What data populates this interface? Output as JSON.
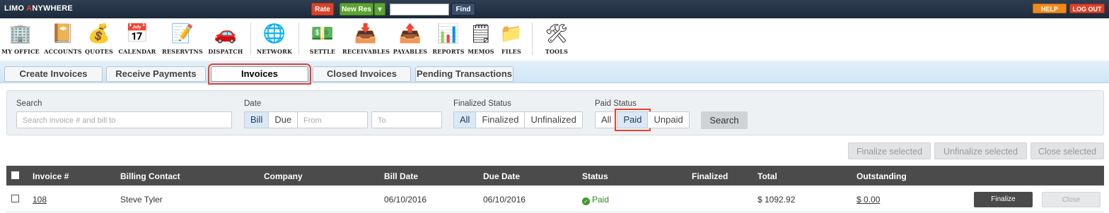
{
  "topbar": {
    "logo_left": "LIMO ",
    "logo_mark": "A",
    "logo_right": "NYWHERE",
    "rate_label": "Rate",
    "newres_label": "New Res",
    "newres_dropdown": "▾",
    "find_label": "Find",
    "search_value": "",
    "help_label": "HELP",
    "logout_label": "LOG OUT"
  },
  "iconbar": {
    "items": [
      {
        "label": "MY OFFICE",
        "icon": "office-building-icon",
        "glyph": "🏢"
      },
      {
        "label": "ACCOUNTS",
        "icon": "address-book-icon",
        "glyph": "📔"
      },
      {
        "label": "QUOTES",
        "icon": "money-bag-icon",
        "glyph": "💰"
      },
      {
        "label": "CALENDAR",
        "icon": "calendar-icon",
        "glyph": "📅"
      },
      {
        "label": "RESERVTNS",
        "icon": "notepad-icon",
        "glyph": "📝"
      },
      {
        "label": "DISPATCH",
        "icon": "car-icon",
        "glyph": "🚗"
      },
      {
        "label": "NETWORK",
        "icon": "globe-icon",
        "glyph": "🌐"
      },
      {
        "label": "SETTLE",
        "icon": "cash-icon",
        "glyph": "💵"
      },
      {
        "label": "RECEIVABLES",
        "icon": "inbox-icon",
        "glyph": "📥"
      },
      {
        "label": "PAYABLES",
        "icon": "outbox-icon",
        "glyph": "📤"
      },
      {
        "label": "REPORTS",
        "icon": "pie-chart-icon",
        "glyph": "📊"
      },
      {
        "label": "MEMOS",
        "icon": "sticky-note-icon",
        "glyph": "🗒"
      },
      {
        "label": "FILES",
        "icon": "folder-icon",
        "glyph": "📁"
      },
      {
        "label": "TOOLS",
        "icon": "tools-icon",
        "glyph": "🛠"
      }
    ]
  },
  "tabs": [
    {
      "label": "Create Invoices"
    },
    {
      "label": "Receive Payments"
    },
    {
      "label": "Invoices"
    },
    {
      "label": "Closed Invoices"
    },
    {
      "label": "Pending Transactions"
    }
  ],
  "filters": {
    "search_label": "Search",
    "search_placeholder": "Search invoice # and bill to",
    "date_label": "Date",
    "date_bill": "Bill",
    "date_due": "Due",
    "date_from_placeholder": "From",
    "date_to_placeholder": "To",
    "finalized_label": "Finalized Status",
    "finalized_all": "All",
    "finalized_finalized": "Finalized",
    "finalized_unfinalized": "Unfinalized",
    "paid_label": "Paid Status",
    "paid_all": "All",
    "paid_paid": "Paid",
    "paid_unpaid": "Unpaid",
    "search_button": "Search"
  },
  "bulk_actions": {
    "finalize_selected": "Finalize selected",
    "unfinalize_selected": "Unfinalize selected",
    "close_selected": "Close selected"
  },
  "table": {
    "columns": [
      "Invoice #",
      "Billing Contact",
      "Company",
      "Bill Date",
      "Due Date",
      "Status",
      "Finalized",
      "Total",
      "Outstanding"
    ],
    "rows": [
      {
        "invoice": "108",
        "billing_contact": "Steve Tyler",
        "company": "",
        "bill_date": "06/10/2016",
        "due_date": "06/10/2016",
        "status": "Paid",
        "finalized": "",
        "total": "$ 1092.92",
        "outstanding": "$ 0.00",
        "finalize_label": "Finalize",
        "close_label": "Close"
      }
    ]
  },
  "colors": {
    "highlight": "#e0452e",
    "topbar": "#2e3e52",
    "paid_green": "#3b9a2c",
    "table_header": "#4b4b4b"
  }
}
